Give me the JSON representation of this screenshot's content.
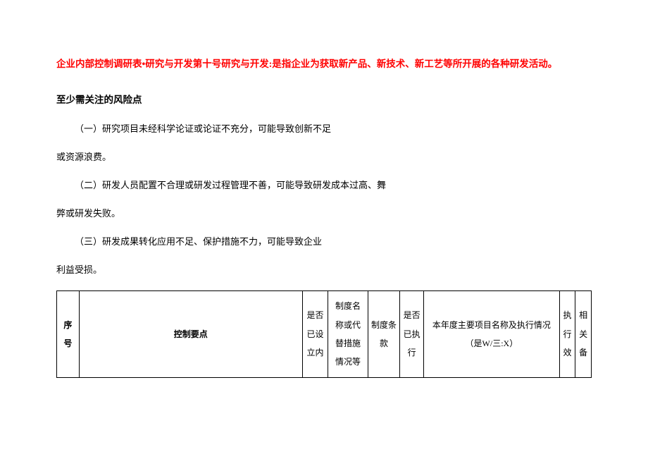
{
  "title_line": "企业内部控制调研表•研究与开发第十号研究与开发:是指企业为获取新产品、新技术、新工艺等所开展的各种研发活动。",
  "heading": "至少需关注的风险点",
  "paragraphs": {
    "p1a": "（一）研究项目未经科学论证或论证不充分，可能导致创新不足",
    "p1b": "或资源浪费。",
    "p2a": "（二）研发人员配置不合理或研发过程管理不善，可能导致研发成本过高、舞",
    "p2b": "弊或研发失败。",
    "p3a": "（三）研发成果转化应用不足、保护措施不力，可能导致企业",
    "p3b": "利益受损。"
  },
  "table": {
    "headers": {
      "seq": "序号",
      "main": "控制要点",
      "set": "是否已设立内",
      "sys": "制度名称或代替措施情况等",
      "clause": "制度条款",
      "exec": "是否已执行",
      "proj_l1": "本年度主要项目名称及执行情况",
      "proj_l2": "（是W/三:X）",
      "eff": "执行效",
      "note": "相关备"
    }
  }
}
